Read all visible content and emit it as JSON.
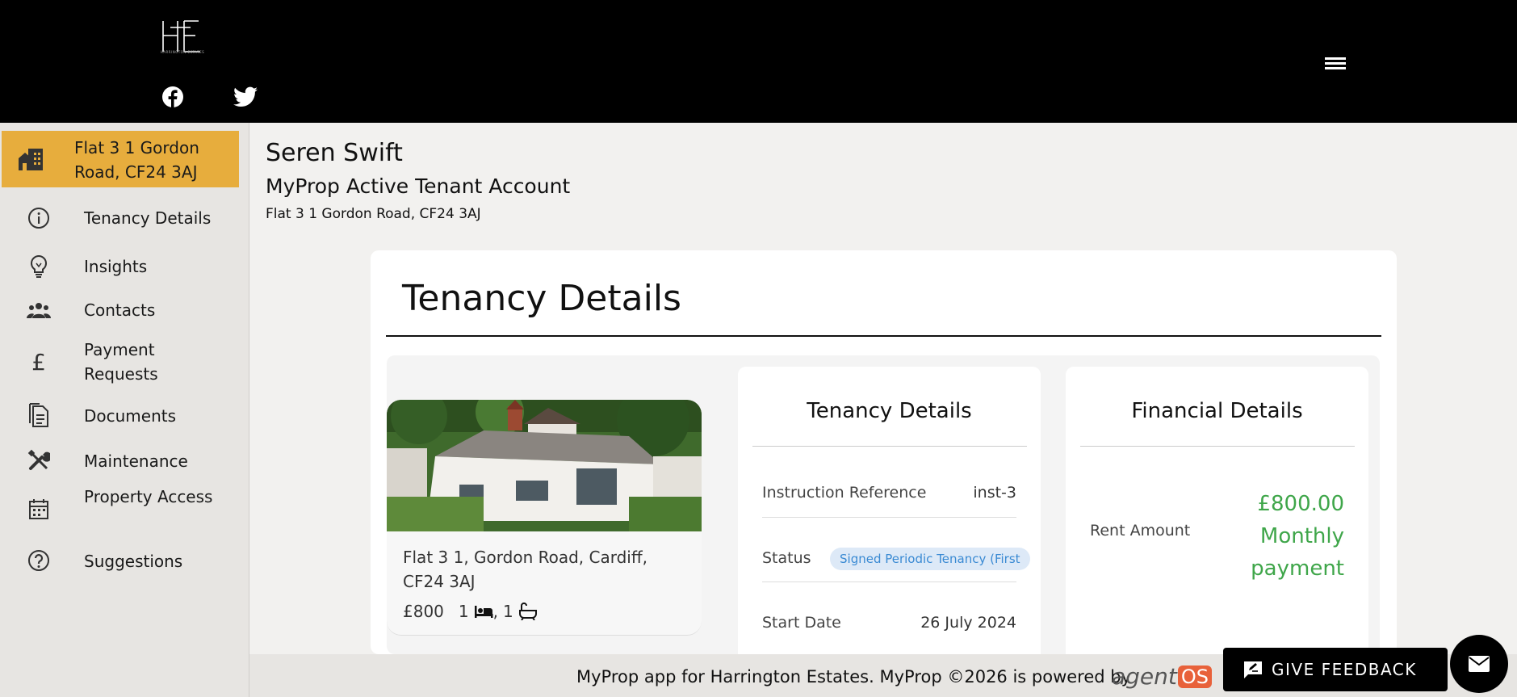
{
  "header": {
    "logo_text": "HE",
    "logo_subtitle": "HARRINGTON ESTATES",
    "social": [
      "facebook-icon",
      "twitter-icon"
    ],
    "menu_icon": "hamburger-icon"
  },
  "sidebar": {
    "active": {
      "label": "Flat 3 1 Gordon Road, CF24 3AJ",
      "icon": "building-icon"
    },
    "items": [
      {
        "label": "Tenancy Details",
        "icon": "info-icon"
      },
      {
        "label": "Insights",
        "icon": "lightbulb-icon"
      },
      {
        "label": "Contacts",
        "icon": "people-icon"
      },
      {
        "label": "Payment Requests",
        "icon": "pound-icon"
      },
      {
        "label": "Documents",
        "icon": "documents-icon"
      },
      {
        "label": "Maintenance",
        "icon": "tools-icon"
      },
      {
        "label": "Property Access",
        "icon": "calendar-icon"
      },
      {
        "label": "Suggestions",
        "icon": "question-icon"
      }
    ]
  },
  "main": {
    "user_name": "Seren Swift",
    "account_title": "MyProp Active Tenant Account",
    "account_address": "Flat 3 1 Gordon Road, CF24 3AJ",
    "card_title": "Tenancy Details",
    "property": {
      "address": "Flat 3 1, Gordon Road, Cardiff, CF24 3AJ",
      "price": "£800",
      "beds": "1",
      "baths": "1"
    },
    "tenancy": {
      "title": "Tenancy Details",
      "instruction_label": "Instruction Reference",
      "instruction_value": "inst-3",
      "status_label": "Status",
      "status_value": "Signed Periodic Tenancy (First",
      "start_label": "Start Date",
      "start_value": "26 July 2024"
    },
    "financial": {
      "title": "Financial Details",
      "rent_label": "Rent Amount",
      "rent_value": "£800.00",
      "rent_period_1": "Monthly",
      "rent_period_2": "payment"
    }
  },
  "footer": {
    "text": "MyProp app for Harrington Estates. MyProp ©2026 is powered by",
    "brand_a": "agent",
    "brand_b": "OS"
  },
  "feedback": {
    "label": "GIVE FEEDBACK"
  },
  "colors": {
    "accent": "#e7ad3d",
    "money": "#3fa64a",
    "badge_bg": "#dde9f7",
    "badge_text": "#3a8ad3",
    "agentos": "#e8613a"
  }
}
